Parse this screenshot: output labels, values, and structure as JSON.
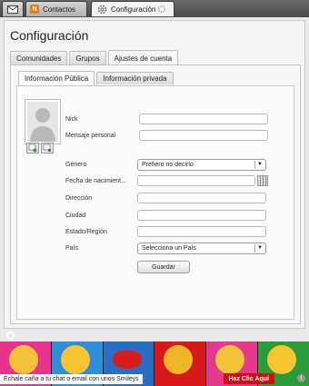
{
  "window": {
    "tabs": [
      {
        "label": "",
        "icon": "mail-icon"
      },
      {
        "label": "Contactos",
        "icon": "contacts-icon"
      },
      {
        "label": "Configuración",
        "icon": "gear-icon"
      }
    ],
    "contacts_icon_letter": "N"
  },
  "page": {
    "title": "Configuración",
    "tabs": [
      {
        "label": "Comunidades"
      },
      {
        "label": "Grupos"
      },
      {
        "label": "Ajustes de cuenta"
      }
    ],
    "subtabs": [
      {
        "label": "Información Pública"
      },
      {
        "label": "Información privada"
      }
    ]
  },
  "form": {
    "nick_label": "Nick",
    "nick_value": "",
    "message_label": "Mensaje personal",
    "message_value": "",
    "gender_label": "Género",
    "gender_value": "Prefiero no decirlo",
    "birthdate_label": "Fecha de nacimient...",
    "birthdate_value": "",
    "address_label": "Dirección",
    "address_value": "",
    "city_label": "Ciudad",
    "city_value": "",
    "state_label": "Estado/Región",
    "state_value": "",
    "country_label": "País",
    "country_value": "Selecciona un País",
    "save_label": "Guardar"
  },
  "ad": {
    "text": "Échale caña a tu chat o email con unos Smileys",
    "cta": "Haz Clic Aquí",
    "info": "i"
  },
  "colors": {
    "ad_red": "#d30e0e",
    "contacts_orange": "#f07a18"
  }
}
